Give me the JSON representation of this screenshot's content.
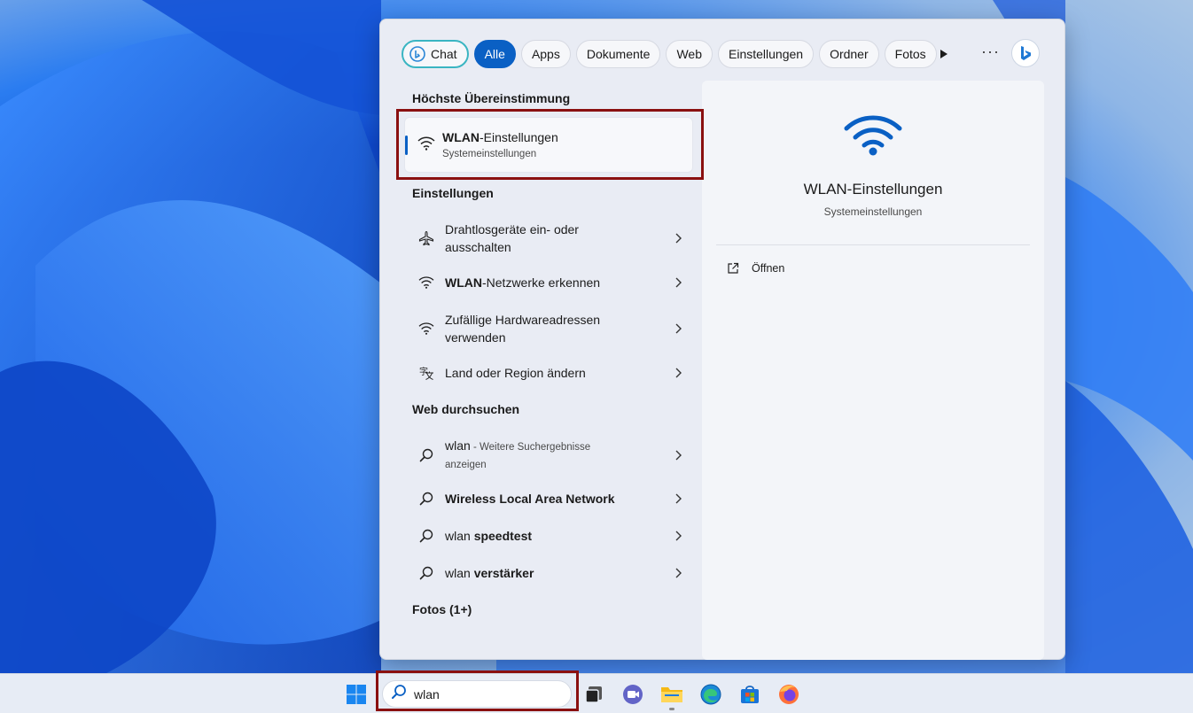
{
  "filters": [
    {
      "label": "Chat"
    },
    {
      "label": "Alle"
    },
    {
      "label": "Apps"
    },
    {
      "label": "Dokumente"
    },
    {
      "label": "Web"
    },
    {
      "label": "Einstellungen"
    },
    {
      "label": "Ordner"
    },
    {
      "label": "Fotos"
    }
  ],
  "more_label": "···",
  "sections": {
    "best_match": "Höchste Übereinstimmung",
    "settings": "Einstellungen",
    "web": "Web durchsuchen",
    "photos": "Fotos (1+)"
  },
  "top_match": {
    "title_bold": "WLAN",
    "title_rest": "-Einstellungen",
    "subtitle": "Systemeinstellungen",
    "icon": "wifi-icon"
  },
  "settings_items": [
    {
      "line1": "Drahtlosgeräte ein- oder",
      "line2": "ausschalten",
      "icon": "airplane-icon"
    },
    {
      "bold": "WLAN",
      "rest": "-Netzwerke erkennen",
      "icon": "wifi-icon"
    },
    {
      "line1": "Zufällige Hardwareadressen",
      "line2": "verwenden",
      "icon": "wifi-icon"
    },
    {
      "line1": "Land oder Region ändern",
      "icon": "language-icon"
    }
  ],
  "web_items": [
    {
      "query": "wlan",
      "suffix": " - Weitere Suchergebnisse",
      "suffix2": "anzeigen",
      "icon": "search-icon"
    },
    {
      "bold": "Wireless Local Area Network",
      "icon": "search-icon"
    },
    {
      "prefix": "wlan ",
      "bold": "speedtest",
      "icon": "search-icon"
    },
    {
      "prefix": "wlan ",
      "bold": "verstärker",
      "icon": "search-icon"
    }
  ],
  "preview": {
    "title": "WLAN-Einstellungen",
    "subtitle": "Systemeinstellungen",
    "action": "Öffnen"
  },
  "taskbar": {
    "search_value": "wlan",
    "apps": [
      "start-icon",
      "task-view-icon",
      "teams-chat-icon",
      "file-explorer-icon",
      "edge-icon",
      "store-icon",
      "firefox-icon"
    ]
  },
  "colors": {
    "accent": "#0a60c4",
    "highlight_box": "#8a1010",
    "chat_ring": "#3ab5c2"
  }
}
